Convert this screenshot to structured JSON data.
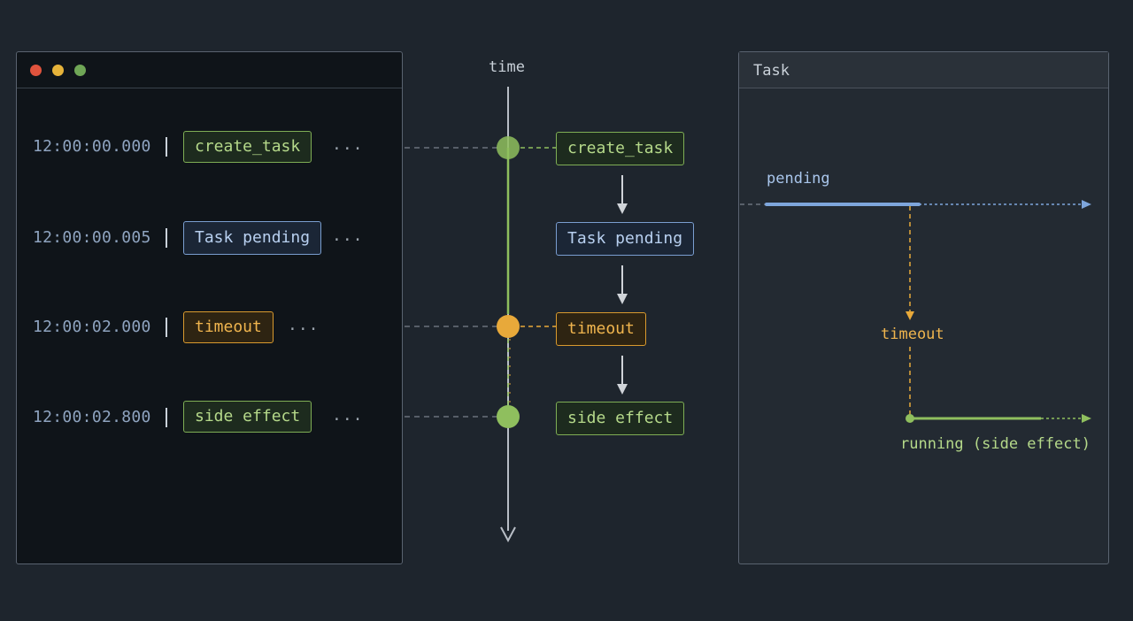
{
  "time_axis": {
    "label": "time"
  },
  "terminal": {
    "rows": [
      {
        "timestamp": "12:00:00.000",
        "event": "create_task",
        "color": "green",
        "ellipsis": "..."
      },
      {
        "timestamp": "12:00:00.005",
        "event": "Task pending",
        "color": "blue",
        "ellipsis": "..."
      },
      {
        "timestamp": "12:00:02.000",
        "event": "timeout",
        "color": "orange",
        "ellipsis": "..."
      },
      {
        "timestamp": "12:00:02.800",
        "event": "side effect",
        "color": "green",
        "ellipsis": "..."
      }
    ]
  },
  "flow": {
    "steps": [
      {
        "label": "create_task",
        "color": "green"
      },
      {
        "label": "Task pending",
        "color": "blue"
      },
      {
        "label": "timeout",
        "color": "orange"
      },
      {
        "label": "side effect",
        "color": "green"
      }
    ]
  },
  "task_panel": {
    "title": "Task",
    "pending_label": "pending",
    "timeout_label": "timeout",
    "running_label": "running (side effect)"
  },
  "colors": {
    "green": "#8fbf5e",
    "blue": "#7ea6dc",
    "orange": "#e8a93a",
    "axis": "#c9ced4"
  }
}
